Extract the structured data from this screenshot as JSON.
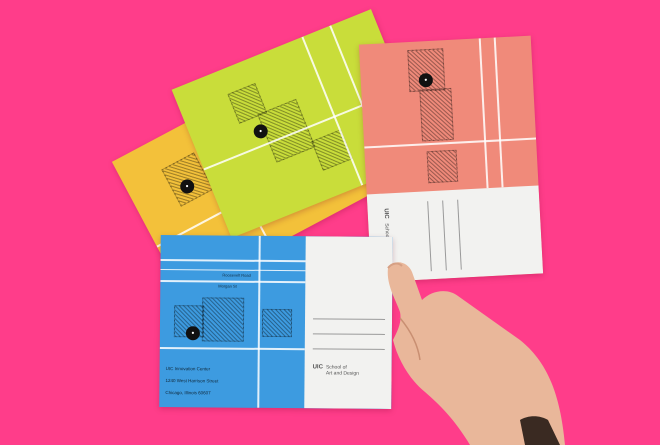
{
  "scene": {
    "description_colors": {
      "background": "#ff3d8a",
      "blue_card": "#3d9be0",
      "yellow_card": "#f3c13a",
      "green_card": "#c9dd3a",
      "salmon_card": "#f08a7a",
      "card_back": "#f2f2f0",
      "skin": "#e9b79a"
    }
  },
  "blue_card": {
    "street_1": "Roosevelt Road",
    "street_2": "Morgan St",
    "venue_line1": "UIC Innovation Center",
    "venue_line2": "1240 West Harrison Street",
    "venue_line3": "Chicago, Illinois 60607",
    "logo_uic": "UIC",
    "logo_school": "School of\nArt and Design"
  },
  "salmon_card": {
    "logo_uic": "UIC",
    "logo_school": "School of\nArt and Design"
  }
}
